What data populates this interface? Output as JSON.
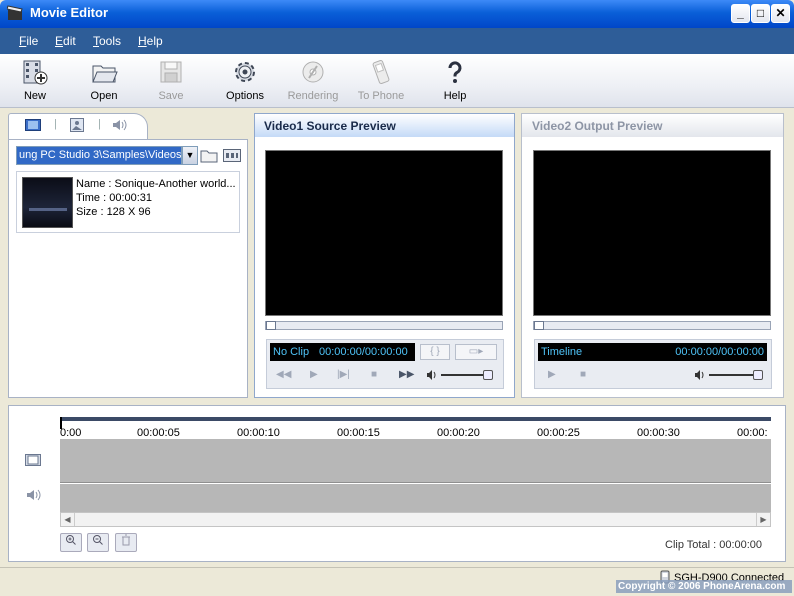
{
  "window": {
    "title": "Movie Editor",
    "controls": [
      "minimize",
      "maximize",
      "close"
    ]
  },
  "menu": [
    {
      "label": "File",
      "accel": "F",
      "rest": "ile"
    },
    {
      "label": "Edit",
      "accel": "E",
      "rest": "dit"
    },
    {
      "label": "Tools",
      "accel": "T",
      "rest": "ools"
    },
    {
      "label": "Help",
      "accel": "H",
      "rest": "elp"
    }
  ],
  "toolbar": {
    "new": "New",
    "open": "Open",
    "save": "Save",
    "options": "Options",
    "rendering": "Rendering",
    "to_phone": "To Phone",
    "help": "Help"
  },
  "library": {
    "path": "ung PC Studio 3\\Samples\\Videos",
    "items": [
      {
        "name": "Name : Sonique-Another world...",
        "time": "Time : 00:00:31",
        "size": "Size : 128 X 96"
      }
    ]
  },
  "source_preview": {
    "title": "Video1 Source Preview",
    "clip_label": "No Clip",
    "time": "00:00:00/00:00:00"
  },
  "output_preview": {
    "title": "Video2 Output Preview",
    "clip_label": "Timeline",
    "time": "00:00:00/00:00:00"
  },
  "timeline": {
    "ticks": [
      "0:00",
      "00:00:05",
      "00:00:10",
      "00:00:15",
      "00:00:20",
      "00:00:25",
      "00:00:30",
      "00:00:"
    ],
    "clip_total": "Clip Total : 00:00:00"
  },
  "status": {
    "device": "SGH-D900 Connected",
    "watermark": "Copyright © 2006  PhoneArena.com"
  },
  "colors": {
    "title_bar": "#0a5fd8",
    "menu_bar": "#2e5d98",
    "lcd_text": "#4fc3f7",
    "track": "#b7b7b7"
  }
}
